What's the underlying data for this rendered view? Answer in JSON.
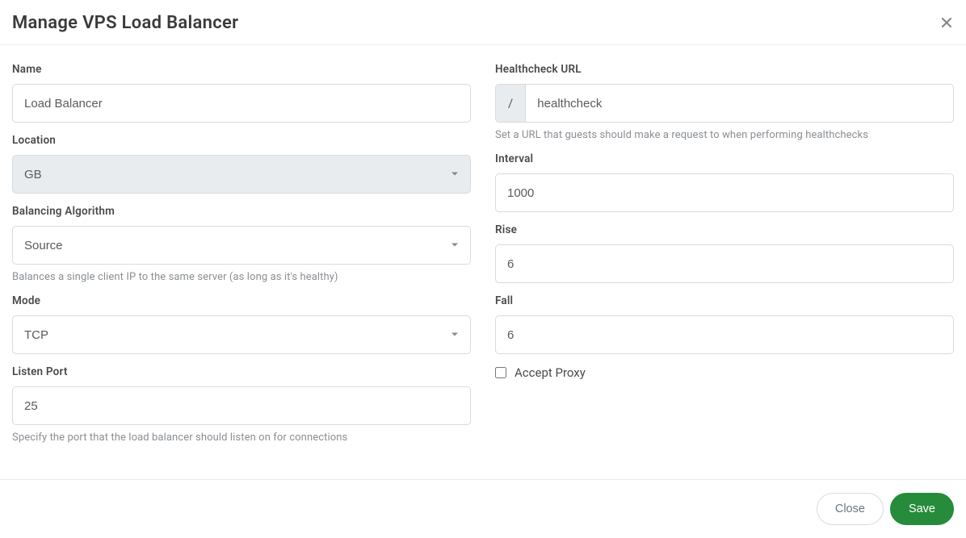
{
  "modal": {
    "title": "Manage VPS Load Balancer"
  },
  "left": {
    "name": {
      "label": "Name",
      "value": "Load Balancer"
    },
    "location": {
      "label": "Location",
      "value": "GB"
    },
    "algorithm": {
      "label": "Balancing Algorithm",
      "value": "Source",
      "help": "Balances a single client IP to the same server (as long as it's healthy)"
    },
    "mode": {
      "label": "Mode",
      "value": "TCP"
    },
    "port": {
      "label": "Listen Port",
      "value": "25",
      "help": "Specify the port that the load balancer should listen on for connections"
    }
  },
  "right": {
    "healthcheck": {
      "label": "Healthcheck URL",
      "prefix": "/",
      "value": "healthcheck",
      "help": "Set a URL that guests should make a request to when performing healthchecks"
    },
    "interval": {
      "label": "Interval",
      "value": "1000"
    },
    "rise": {
      "label": "Rise",
      "value": "6"
    },
    "fall": {
      "label": "Fall",
      "value": "6"
    },
    "accept_proxy": {
      "label": "Accept Proxy"
    }
  },
  "footer": {
    "close": "Close",
    "save": "Save"
  }
}
